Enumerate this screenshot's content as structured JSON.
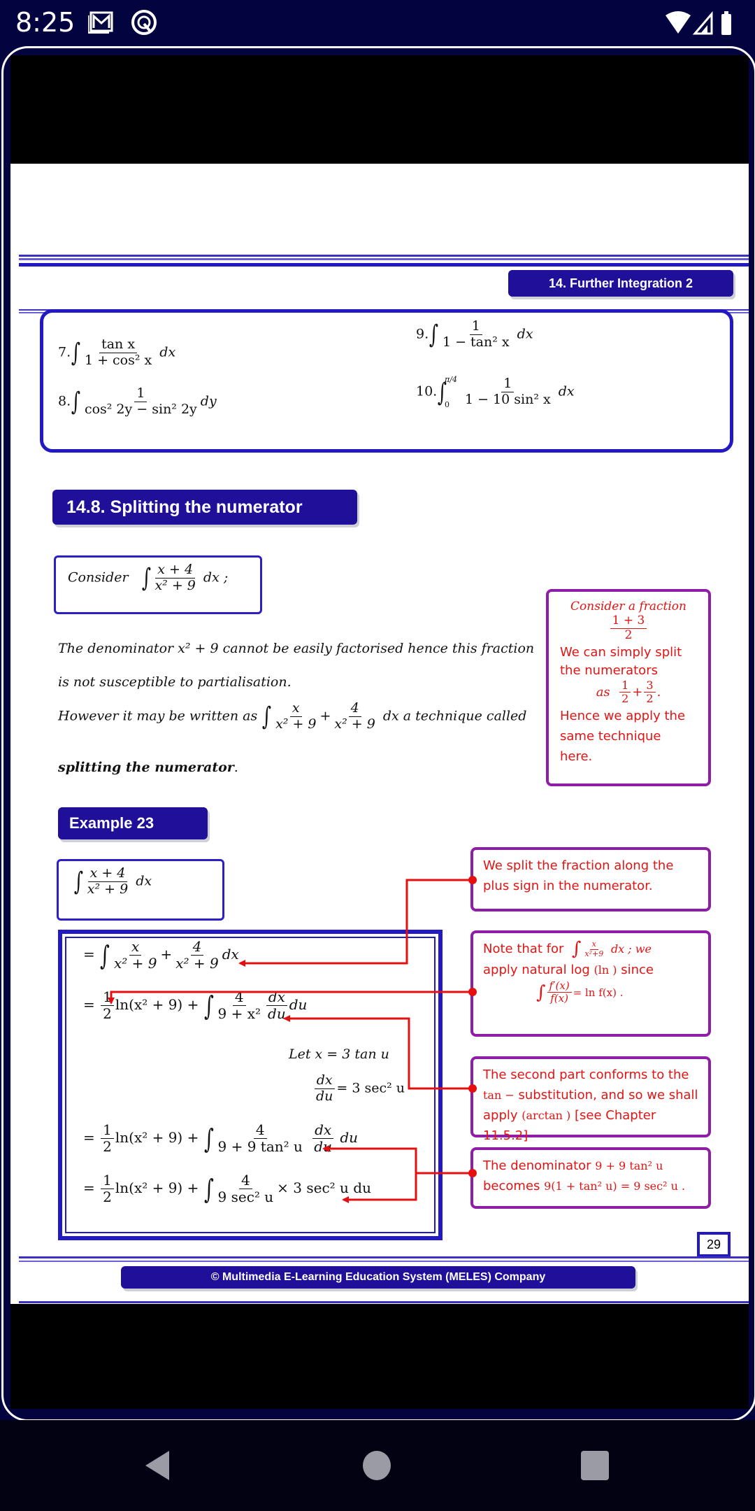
{
  "status_bar": {
    "time": "8:25",
    "left_icons": [
      "gmail-icon",
      "q-app-icon"
    ],
    "right_icons": [
      "wifi-icon",
      "cell-signal-icon",
      "battery-icon"
    ]
  },
  "header": {
    "chapter_label": "14. Further Integration 2"
  },
  "exercises": {
    "items": [
      {
        "number": "7.",
        "numerator": "tan x",
        "denominator": "1 + cos² x",
        "differential": "dx"
      },
      {
        "number": "8.",
        "numerator": "1",
        "denominator": "cos² 2y − sin² 2y",
        "differential": "dy"
      },
      {
        "number": "9.",
        "numerator": "1",
        "denominator": "1 − tan² x",
        "differential": "dx"
      },
      {
        "number": "10.",
        "numerator": "1",
        "denominator": "1 − 10 sin² x",
        "differential": "dx",
        "lower_limit": "0",
        "upper_limit": "π/4"
      }
    ]
  },
  "section": {
    "title": "14.8. Splitting the numerator",
    "consider": {
      "label": "Consider",
      "numerator": "x + 4",
      "denominator": "x² + 9",
      "tail": "dx ;"
    },
    "paragraph_line1": "The denominator x² + 9 cannot be easily factorised hence this fraction",
    "paragraph_line1_a": "The denominator ",
    "paragraph_line1_b": " cannot be easily factorised hence this fraction",
    "paragraph_line2": "is not susceptible to partialisation.",
    "paragraph_line3_a": "However it may be written as",
    "paragraph_line3_b": "dx  a technique called",
    "paragraph_line4_bold": "splitting the numerator",
    "paragraph_line4_end": ".",
    "split": {
      "n1": "x",
      "d1": "x² + 9",
      "n2": "4",
      "d2": "x² + 9"
    }
  },
  "side_note": {
    "line1": "Consider a fraction",
    "frac_num": "1 + 3",
    "frac_den": "2",
    "line2": "We can simply split",
    "line3": "the numerators",
    "as": "as",
    "split_a_num": "1",
    "split_a_den": "2",
    "split_b_num": "3",
    "split_b_den": "2",
    "line4": "Hence we apply the",
    "line5": "same technique here."
  },
  "example": {
    "title": "Example 23",
    "problem": {
      "numerator": "x + 4",
      "denominator": "x² + 9",
      "differential": "dx"
    },
    "steps": {
      "s1": {
        "n1": "x",
        "d1": "x² + 9",
        "n2": "4",
        "d2": "x² + 9",
        "tail": "dx"
      },
      "s2": {
        "coef_num": "1",
        "coef_den": "2",
        "log": "ln(x² + 9) +",
        "n": "4",
        "d": "9 + x²",
        "dn": "dx",
        "dd": "du",
        "tail": "du"
      },
      "let": "Let  x = 3 tan u",
      "deriv": {
        "num": "dx",
        "den": "du",
        "rhs": "= 3 sec² u"
      },
      "s3": {
        "coef_num": "1",
        "coef_den": "2",
        "log": "ln(x² + 9) +",
        "n": "4",
        "d": "9 + 9 tan² u",
        "dn": "dx",
        "dd": "du",
        "tail": "du"
      },
      "s4": {
        "coef_num": "1",
        "coef_den": "2",
        "log": "ln(x² + 9) +",
        "n": "4",
        "d": "9 sec² u",
        "tail": "× 3 sec² u du"
      }
    }
  },
  "notes": {
    "n1": {
      "line1": "We split the fraction along the",
      "line2": "plus sign in the numerator."
    },
    "n2": {
      "a": "Note that for",
      "frac_n": "x",
      "frac_d": "x²+9",
      "b": "dx ; we",
      "line2_a": "apply natural log ",
      "line2_m": "(ln )",
      "line2_b": " since",
      "f_num": "f′(x)",
      "f_den": "f(x)",
      "f_rhs": "=  ln f(x)  ."
    },
    "n3": {
      "line1": "The second part conforms to the",
      "line2_m": "tan −",
      "line2_b": " substitution, and so we shall",
      "line3_a": "apply ",
      "line3_m": "(arctan )",
      "line3_b": " [see Chapter 11.5.2]"
    },
    "n4": {
      "line1_a": "The denominator ",
      "line1_m": "9 + 9 tan² u",
      "line2_a": "becomes ",
      "line2_m": "9(1 + tan² u) = 9 sec² u  ."
    }
  },
  "footer": {
    "page_number": "29",
    "copyright": "© Multimedia E-Learning Education System (MELES) Company"
  },
  "colors": {
    "brand_navy": "#1f0f99",
    "rule_blue": "#2218c4",
    "note_border": "#8e1ea8",
    "note_text": "#e31414",
    "status_bg": "#03033f"
  },
  "nav": {
    "buttons": [
      "back",
      "home",
      "recents"
    ]
  }
}
